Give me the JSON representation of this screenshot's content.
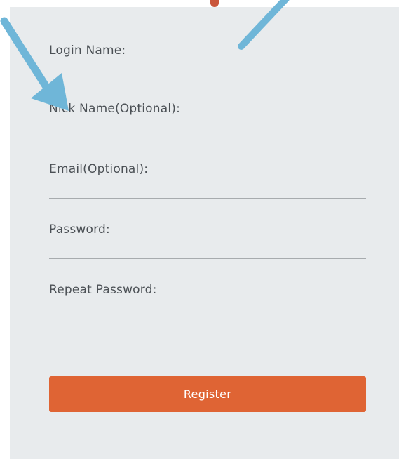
{
  "form": {
    "fields": [
      {
        "label": "Login Name:",
        "value": ""
      },
      {
        "label": "Nick Name(Optional):",
        "value": ""
      },
      {
        "label": "Email(Optional):",
        "value": ""
      },
      {
        "label": "Password:",
        "value": ""
      },
      {
        "label": "Repeat Password:",
        "value": ""
      }
    ],
    "register_label": "Register"
  },
  "colors": {
    "panel_background": "#e8ebed",
    "accent": "#df6434",
    "annotation_arrow": "#6fb6d8"
  }
}
